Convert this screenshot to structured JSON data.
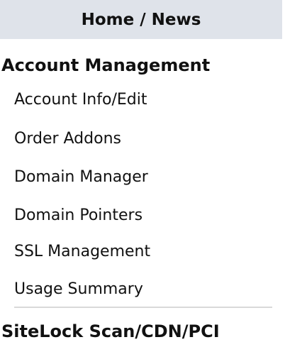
{
  "nav": {
    "home_news": "Home / News",
    "account_management": "Account Management",
    "items": [
      "Account Info/Edit",
      "Order Addons",
      "Domain Manager",
      "Domain Pointers",
      "SSL Management",
      "Usage Summary"
    ],
    "sitelock": "SiteLock Scan/CDN/PCI"
  },
  "colors": {
    "header_bar_bg": "#dfe3ea",
    "divider": "#d9d9d9",
    "text": "#111111"
  }
}
